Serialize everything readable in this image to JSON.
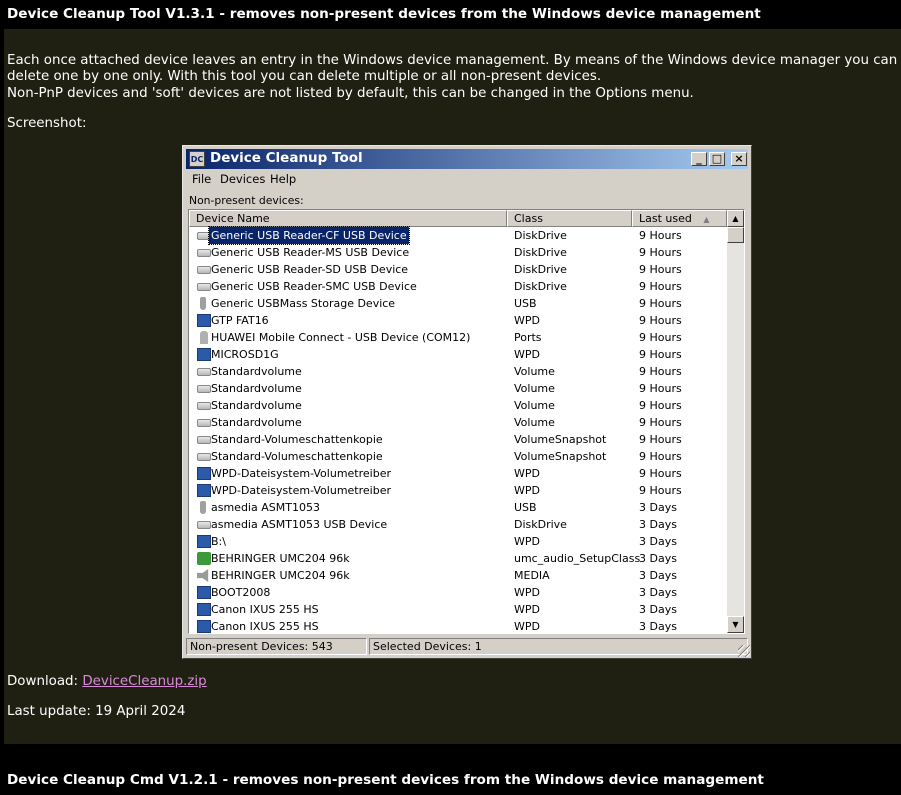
{
  "header1": "Device Cleanup Tool V1.3.1 - removes non-present devices from the Windows device management",
  "intro": {
    "line1": "Each once attached device leaves an entry in the Windows device management. By means of the Windows device manager you can",
    "line2": "delete one by one only. With this tool you can delete multiple or all non-present devices.",
    "line3": "Non-PnP devices and 'soft' devices are not listed by default, this can be changed in the Options menu."
  },
  "screenshot_label": "Screenshot:",
  "window": {
    "icon_text": "DC",
    "title": "Device Cleanup Tool",
    "menu": [
      "File",
      "Devices",
      "Help"
    ],
    "list_label": "Non-present devices:",
    "columns": [
      "Device Name",
      "Class",
      "Last used"
    ],
    "sort_indicator": "▲",
    "rows": [
      {
        "name": "Generic USB Reader-CF USB Device",
        "class": "DiskDrive",
        "last": "9 Hours",
        "icon": "drive-icon"
      },
      {
        "name": "Generic USB Reader-MS USB Device",
        "class": "DiskDrive",
        "last": "9 Hours",
        "icon": "drive-icon"
      },
      {
        "name": "Generic USB Reader-SD USB Device",
        "class": "DiskDrive",
        "last": "9 Hours",
        "icon": "drive-icon"
      },
      {
        "name": "Generic USB Reader-SMC USB Device",
        "class": "DiskDrive",
        "last": "9 Hours",
        "icon": "drive-icon"
      },
      {
        "name": "Generic USBMass Storage Device",
        "class": "USB",
        "last": "9 Hours",
        "icon": "usb-icon"
      },
      {
        "name": "GTP FAT16",
        "class": "WPD",
        "last": "9 Hours",
        "icon": "wpd-icon"
      },
      {
        "name": "HUAWEI Mobile Connect - USB Device (COM12)",
        "class": "Ports",
        "last": "9 Hours",
        "icon": "port-icon"
      },
      {
        "name": "MICROSD1G",
        "class": "WPD",
        "last": "9 Hours",
        "icon": "wpd-icon"
      },
      {
        "name": "Standardvolume",
        "class": "Volume",
        "last": "9 Hours",
        "icon": "drive-icon"
      },
      {
        "name": "Standardvolume",
        "class": "Volume",
        "last": "9 Hours",
        "icon": "drive-icon"
      },
      {
        "name": "Standardvolume",
        "class": "Volume",
        "last": "9 Hours",
        "icon": "drive-icon"
      },
      {
        "name": "Standardvolume",
        "class": "Volume",
        "last": "9 Hours",
        "icon": "drive-icon"
      },
      {
        "name": "Standard-Volumeschattenkopie",
        "class": "VolumeSnapshot",
        "last": "9 Hours",
        "icon": "drive-icon"
      },
      {
        "name": "Standard-Volumeschattenkopie",
        "class": "VolumeSnapshot",
        "last": "9 Hours",
        "icon": "drive-icon"
      },
      {
        "name": "WPD-Dateisystem-Volumetreiber",
        "class": "WPD",
        "last": "9 Hours",
        "icon": "wpd-icon"
      },
      {
        "name": "WPD-Dateisystem-Volumetreiber",
        "class": "WPD",
        "last": "9 Hours",
        "icon": "wpd-icon"
      },
      {
        "name": "asmedia ASMT1053",
        "class": "USB",
        "last": "3 Days",
        "icon": "usb-icon"
      },
      {
        "name": "asmedia ASMT1053 USB Device",
        "class": "DiskDrive",
        "last": "3 Days",
        "icon": "drive-icon"
      },
      {
        "name": "B:\\",
        "class": "WPD",
        "last": "3 Days",
        "icon": "wpd-icon"
      },
      {
        "name": "BEHRINGER UMC204 96k",
        "class": "umc_audio_SetupClass",
        "last": "3 Days",
        "icon": "umc-icon"
      },
      {
        "name": "BEHRINGER UMC204 96k",
        "class": "MEDIA",
        "last": "3 Days",
        "icon": "speaker-icon"
      },
      {
        "name": "BOOT2008",
        "class": "WPD",
        "last": "3 Days",
        "icon": "wpd-icon"
      },
      {
        "name": "Canon IXUS 255 HS",
        "class": "WPD",
        "last": "3 Days",
        "icon": "wpd-icon"
      },
      {
        "name": "Canon IXUS 255 HS",
        "class": "WPD",
        "last": "3 Days",
        "icon": "wpd-icon"
      }
    ],
    "status_left": "Non-present Devices: 543",
    "status_right": "Selected Devices: 1"
  },
  "download": {
    "label": "Download:",
    "link": "DeviceCleanup.zip"
  },
  "last_update": "Last update: 19 April 2024",
  "header2": "Device Cleanup Cmd V1.2.1 - removes non-present devices from the Windows device management"
}
